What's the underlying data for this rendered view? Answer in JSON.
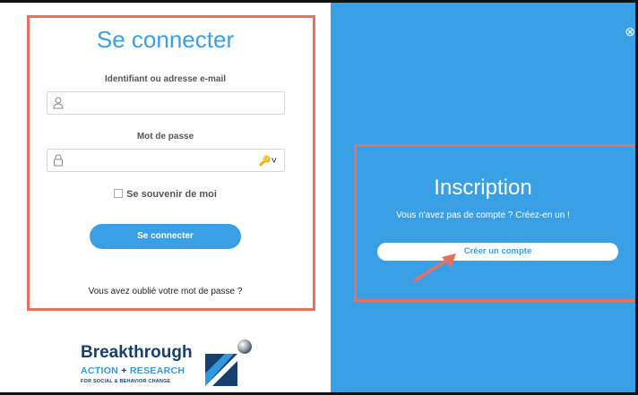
{
  "login": {
    "title": "Se connecter",
    "username_label": "Identifiant ou adresse e-mail",
    "username_value": "",
    "password_label": "Mot de passe",
    "password_value": "",
    "remember_label": "Se souvenir de moi",
    "remember_checked": false,
    "submit_label": "Se connecter",
    "forgot_label": "Vous avez oublié votre mot de passe ?"
  },
  "signup": {
    "title": "Inscription",
    "subtitle": "Vous n'avez pas de compte ? Créez-en un !",
    "create_label": "Créer un compte"
  },
  "logo": {
    "line1": "Breakthrough",
    "line2_a": "ACTION",
    "line2_b": "+",
    "line2_c": "RESEARCH",
    "line3": "FOR SOCIAL & BEHAVIOR CHANGE"
  },
  "icons": {
    "close": "close-icon",
    "user": "user-icon",
    "lock": "lock-icon",
    "key": "key-icon"
  },
  "colors": {
    "accent": "#3aa0e6",
    "highlight": "#e8705f",
    "arrow": "#e8705f",
    "brand_dark": "#16406f"
  }
}
